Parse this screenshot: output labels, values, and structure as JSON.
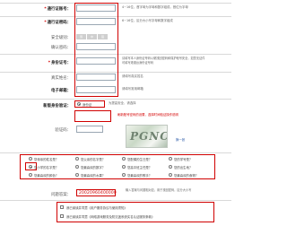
{
  "form": {
    "pass_number_label": "通行证账号：",
    "pass_number_hint": "4~16位，首字母为字母和数字组成，首位为字母",
    "password_label": "通行证密码：",
    "password_hint": "6~16位，区分大小写字母和数字组成",
    "security_label": "安全级别：",
    "security_levels": [
      "弱",
      "中",
      "强"
    ],
    "confirm_password_label": "确认密码：",
    "id_number_label": "身份证号：",
    "id_number_hint": "请填写本人身份证号码以便找回密码和保护帐号安全，如您无证件可填写港澳台身份证号码",
    "real_name_label": "真实姓名：",
    "real_name_hint": "请填写真实姓名",
    "email_label": "电子邮箱：",
    "email_hint": "请填写常用邮箱",
    "verify_method_label": "新版身份验证：",
    "verify_method_option": "身份证",
    "verify_method_hint": "为提高安全，请选择",
    "verify_code_label": "验证码：",
    "verify_code_hint": "刷新账号密码的设置，选择时间验证操作说明",
    "captcha_text": "PGNCI",
    "captcha_refresh": "换一张"
  },
  "question": {
    "options": [
      "您母亲的姓名是？",
      "您父亲的名字是？",
      "您配偶的生日是？",
      "您的学号是？",
      "您小学的名字是？",
      "您最喜欢的数字？",
      "您高中班主任是？",
      "您的出生地？",
      "您最喜欢的颜色？",
      "您最喜欢的水果？",
      "您最喜欢的歌手？",
      "您最喜欢的食物？"
    ],
    "selected_index": 4,
    "answer_label": "问题答案：",
    "answer_value": "20020960400000",
    "answer_hint": "输入答案与问题相对应，用于找回密码，区分大小写"
  },
  "agreements": {
    "item_1": "我已阅读并同意《用户服务协议与使用须知》",
    "item_2": "我已阅读并同意《网络游戏服务及防沉迷系统实名认证服务条款》"
  },
  "colors": {
    "accent": "#d00000",
    "border": "#9aa7b3"
  }
}
